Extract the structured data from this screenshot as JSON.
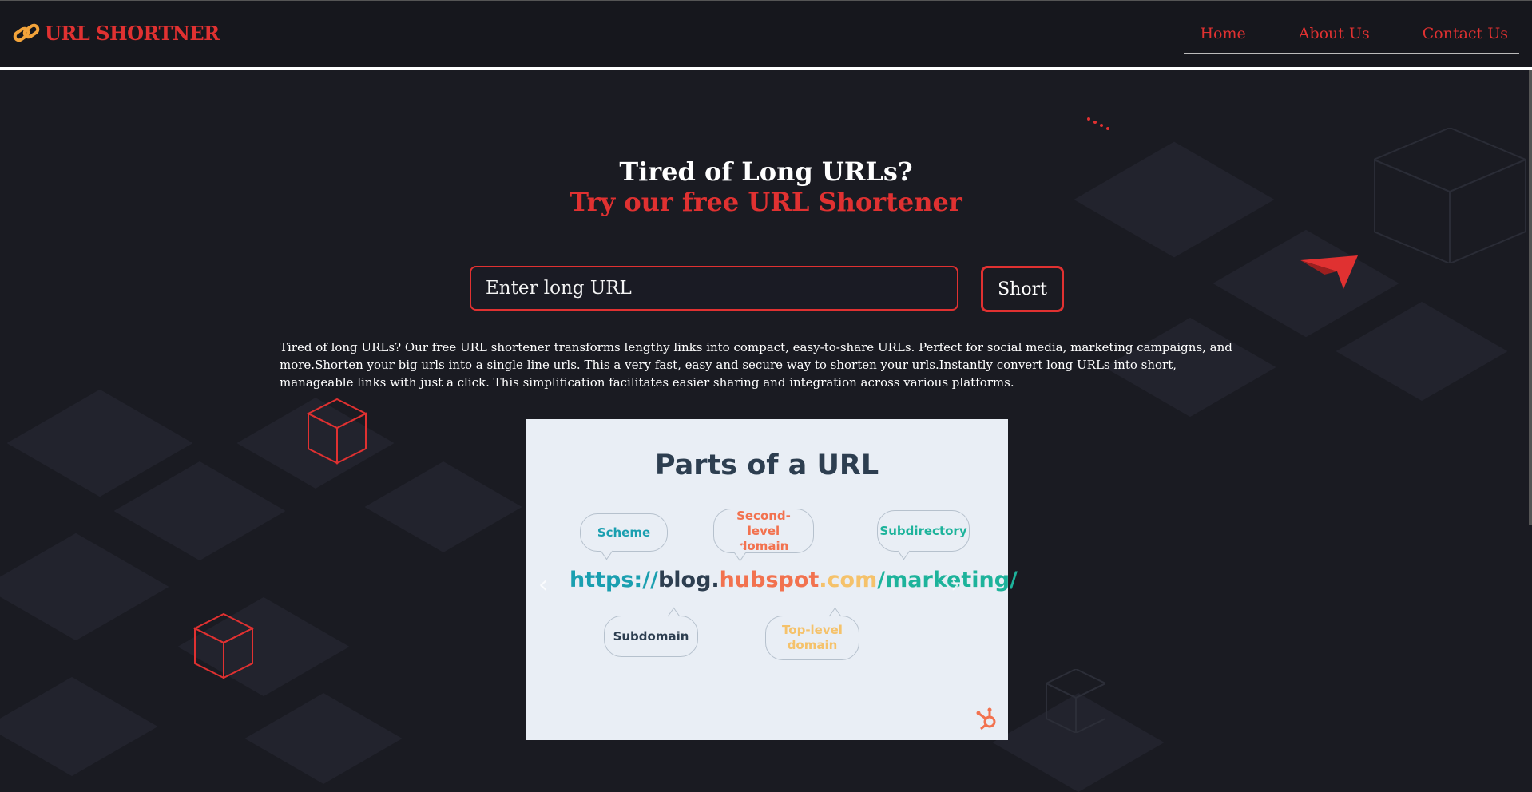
{
  "header": {
    "brand_icon": "link-icon",
    "brand": "URL SHORTNER",
    "nav": [
      {
        "label": "Home"
      },
      {
        "label": "About Us"
      },
      {
        "label": "Contact Us"
      }
    ]
  },
  "hero": {
    "line1": "Tired of Long URLs?",
    "line2": "Try our free URL Shortener"
  },
  "form": {
    "placeholder": "Enter long URL",
    "value": "",
    "button": "Short"
  },
  "description": "Tired of long URLs? Our free URL shortener transforms lengthy links into compact, easy-to-share URLs. Perfect for social media, marketing campaigns, and more.Shorten your big urls into a single line urls. This a very fast, easy and secure way to shorten your urls.Instantly convert long URLs into short, manageable links with just a click. This simplification facilitates easier sharing and integration across various platforms.",
  "slide": {
    "title": "Parts of a URL",
    "labels": {
      "scheme": "Scheme",
      "second_level": "Second-level domain",
      "subdirectory": "Subdirectory",
      "subdomain": "Subdomain",
      "top_level": "Top-level domain"
    },
    "url_parts": {
      "scheme": "https://",
      "subdomain": "blog.",
      "second_level": "hubspot",
      "top_level": ".com",
      "subdirectory": "/marketing/"
    },
    "colors": {
      "scheme": "#1a9fb0",
      "subdomain": "#2d3e50",
      "second_level": "#f2724f",
      "top_level": "#f5c26b",
      "subdirectory": "#1db39b"
    },
    "prev_icon": "chevron-left-icon",
    "next_icon": "chevron-right-icon",
    "logo_icon": "hubspot-logo-icon"
  },
  "colors": {
    "accent": "#e03131",
    "background": "#1a1b22",
    "header": "#16171d"
  }
}
